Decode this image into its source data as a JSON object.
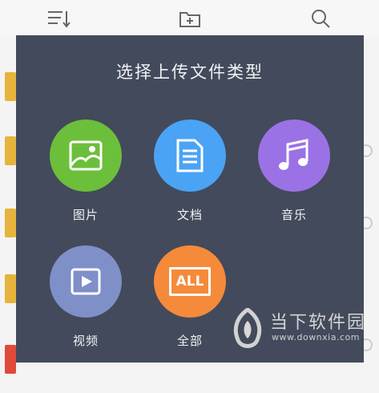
{
  "dialog": {
    "title": "选择上传文件类型",
    "options": [
      {
        "label": "图片",
        "icon": "image-icon",
        "color": "#6cbf3b"
      },
      {
        "label": "文档",
        "icon": "document-icon",
        "color": "#4aa3f4"
      },
      {
        "label": "音乐",
        "icon": "music-icon",
        "color": "#9b72e6"
      },
      {
        "label": "视频",
        "icon": "video-icon",
        "color": "#7f8fc8"
      },
      {
        "label": "全部",
        "icon": "all-files-icon",
        "icon_text": "ALL",
        "color": "#f58a3a"
      }
    ]
  },
  "watermark": {
    "text": "当下软件园",
    "url": "www.downxia.com"
  }
}
